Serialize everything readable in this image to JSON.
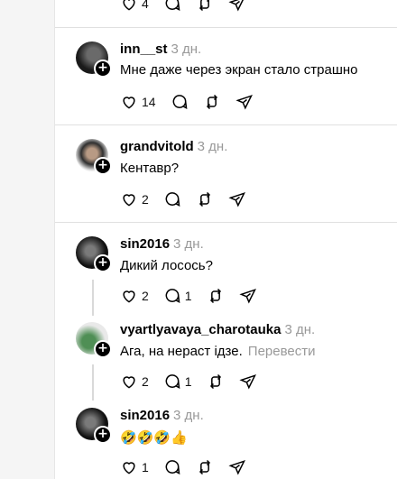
{
  "top_post": {
    "like_count": "4"
  },
  "comments": [
    {
      "username": "inn__st",
      "time": "3 дн.",
      "text": "Мне даже через экран стало страшно",
      "like_count": "14",
      "reply_count": ""
    },
    {
      "username": "grandvitold",
      "time": "3 дн.",
      "text": "Кентавр?",
      "like_count": "2",
      "reply_count": ""
    },
    {
      "username": "sin2016",
      "time": "3 дн.",
      "text": "Дикий лосось?",
      "like_count": "2",
      "reply_count": "1"
    },
    {
      "username": "vyartlyavaya_charotauka",
      "time": "3 дн.",
      "text": "Ага, на нераст ідзе.",
      "translate_label": "Перевести",
      "like_count": "2",
      "reply_count": "1"
    },
    {
      "username": "sin2016",
      "time": "3 дн.",
      "text": "🤣🤣🤣👍",
      "like_count": "1",
      "reply_count": ""
    }
  ]
}
